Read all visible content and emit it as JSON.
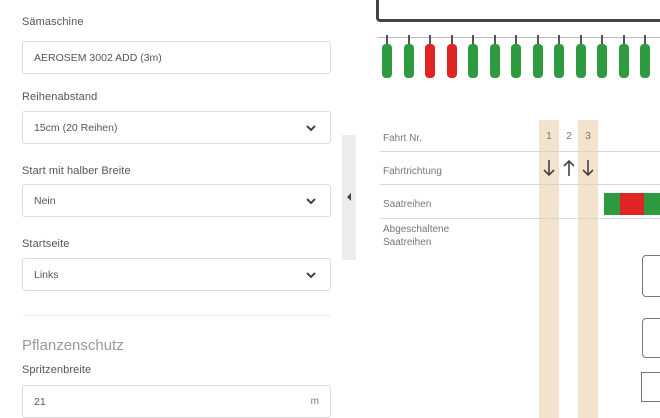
{
  "form": {
    "machine": {
      "label": "Sämaschine",
      "value": "AEROSEM 3002 ADD (3m)"
    },
    "row_spacing": {
      "label": "Reihenabstand",
      "value": "15cm (20 Reihen)"
    },
    "half_width_start": {
      "label": "Start mit halber Breite",
      "value": "Nein"
    },
    "start_side": {
      "label": "Startseite",
      "value": "Links"
    },
    "plant_protection": {
      "title": "Pflanzenschutz",
      "sprayer_width": {
        "label": "Spritzenbreite",
        "value": "21",
        "unit": "m"
      }
    }
  },
  "visualization": {
    "row_labels": {
      "trip_no": "Fahrt Nr.",
      "direction": "Fahrtrichtung",
      "seed_rows": "Saatreihen",
      "disabled_rows_line1": "Abgeschaltene",
      "disabled_rows_line2": "Saatreihen"
    },
    "trips": [
      "1",
      "2",
      "3"
    ],
    "directions": [
      "down",
      "up",
      "down"
    ],
    "coulter_states": [
      "green",
      "green",
      "red",
      "red",
      "green",
      "green",
      "green",
      "green",
      "green",
      "green",
      "green",
      "green",
      "green"
    ],
    "colors": {
      "active": "#2e9b40",
      "disabled": "#e02424",
      "lane": "#f3e2cc"
    }
  }
}
